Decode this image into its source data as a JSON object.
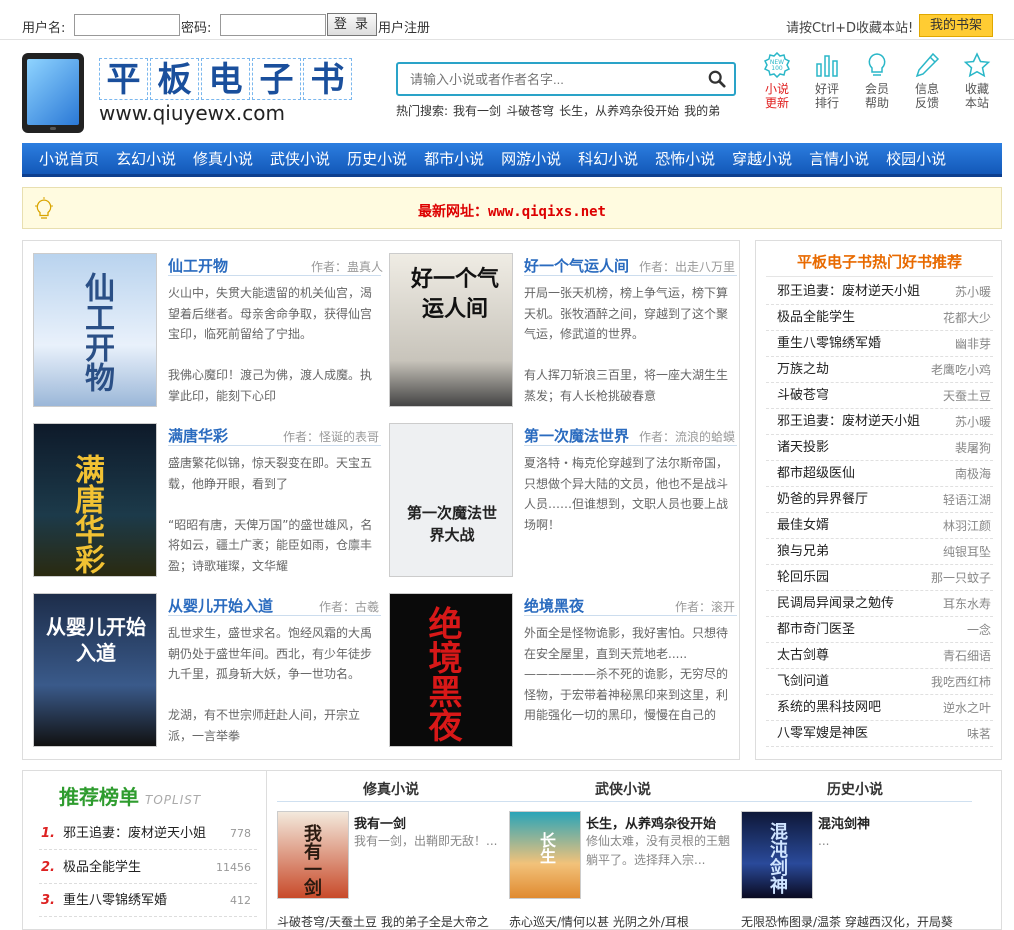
{
  "topbar": {
    "username_label": "用户名:",
    "username_value": "",
    "password_label": "密码:",
    "password_value": "",
    "login_label": "登 录",
    "register_label": "用户注册",
    "fav_tip": "请按Ctrl+D收藏本站!",
    "shelf_label": "我的书架"
  },
  "logo": {
    "chars": [
      "平",
      "板",
      "电",
      "子",
      "书"
    ],
    "url": "www.qiuyewx.com"
  },
  "search": {
    "placeholder": "请输入小说或者作者名字...",
    "hot_label": "热门搜索:",
    "hot_items": [
      "我有一剑",
      "斗破苍穹",
      "长生，从养鸡杂役开始",
      "我的弟"
    ]
  },
  "quick_icons": [
    {
      "icon": "new-icon",
      "line1": "小说",
      "line2": "更新",
      "color": "#e02020"
    },
    {
      "icon": "bar-chart-icon",
      "line1": "好评",
      "line2": "排行",
      "color": "#2ab7c8"
    },
    {
      "icon": "lightbulb-icon",
      "line1": "会员",
      "line2": "帮助",
      "color": "#2ab7c8"
    },
    {
      "icon": "pencil-icon",
      "line1": "信息",
      "line2": "反馈",
      "color": "#2ab7c8"
    },
    {
      "icon": "star-icon",
      "line1": "收藏",
      "line2": "本站",
      "color": "#2ab7c8"
    }
  ],
  "nav": [
    "小说首页",
    "玄幻小说",
    "修真小说",
    "武侠小说",
    "历史小说",
    "都市小说",
    "网游小说",
    "科幻小说",
    "恐怖小说",
    "穿越小说",
    "言情小说",
    "校园小说"
  ],
  "notice": {
    "text": "最新网址：www.qiqixs.net"
  },
  "featured": [
    {
      "title": "仙工开物",
      "author": "作者：蛊真人",
      "desc": "火山中，失贯大能遗留的机关仙宫，渴望着后继者。母亲舍命争取，获得仙宫宝印，临死前留给了宁拙。\n\n我佛心魔印！渡己为佛，渡人成魔。执掌此印，能刻下心印",
      "cover": "仙工开物"
    },
    {
      "title": "好一个气运人间",
      "author": "作者：出走八万里",
      "desc": "开局一张天机榜，榜上争气运，榜下算天机。张牧酒醉之间，穿越到了这个聚气运，修武道的世界。\n\n有人挥刀斩浪三百里，将一座大湖生生蒸发；有人长枪挑破春意",
      "cover": "好一个气运人间"
    },
    {
      "title": "满唐华彩",
      "author": "作者：怪诞的表哥",
      "desc": "盛唐繁花似锦，惊天裂变在即。天宝五载，他睁开眼，看到了\n\n“昭昭有唐，天俾万国”的盛世雄风，名将如云，疆土广袤；能臣如雨，仓廪丰盈；诗歌璀璨，文华耀",
      "cover": "满唐华彩"
    },
    {
      "title": "第一次魔法世界",
      "author": "作者：流浪的蛤蟆",
      "desc": "夏洛特・梅克伦穿越到了法尔斯帝国，只想做个异大陆的文员，他也不是战斗人员……但谁想到，文职人员也要上战场啊！",
      "cover": "第一次魔法世界大战"
    },
    {
      "title": "从婴儿开始入道",
      "author": "作者：古羲",
      "desc": "乱世求生，盛世求名。饱经风霜的大禹朝仍处于盛世年间。西北，有少年徒步九千里，孤身斩大妖，争一世功名。\n\n龙湖，有不世宗师赶赴人间，开宗立派，一言举拳",
      "cover": "从婴儿开始入道"
    },
    {
      "title": "绝境黑夜",
      "author": "作者：滚开",
      "desc": "外面全是怪物诡影，我好害怕。只想待在安全屋里，直到天荒地老.....——————杀不死的诡影，无穷尽的怪物，于宏带着神秘黑印来到这里，利用能强化一切的黑印，慢慢在自己的",
      "cover": "绝境黑夜"
    }
  ],
  "hot_recommend": {
    "title": "平板电子书热门好书推荐",
    "items": [
      {
        "name": "邪王追妻：废材逆天小姐",
        "author": "苏小暖"
      },
      {
        "name": "极品全能学生",
        "author": "花都大少"
      },
      {
        "name": "重生八零锦绣军婚",
        "author": "幽非芽"
      },
      {
        "name": "万族之劫",
        "author": "老鹰吃小鸡"
      },
      {
        "name": "斗破苍穹",
        "author": "天蚕土豆"
      },
      {
        "name": "邪王追妻：废材逆天小姐",
        "author": "苏小暖"
      },
      {
        "name": "诸天投影",
        "author": "裴屠狗"
      },
      {
        "name": "都市超级医仙",
        "author": "南极海"
      },
      {
        "name": "奶爸的异界餐厅",
        "author": "轻语江湖"
      },
      {
        "name": "最佳女婿",
        "author": "林羽江颜"
      },
      {
        "name": "狼与兄弟",
        "author": "纯银耳坠"
      },
      {
        "name": "轮回乐园",
        "author": "那一只蚊子"
      },
      {
        "name": "民调局异闻录之勉传",
        "author": "耳东水寿"
      },
      {
        "name": "都市奇门医圣",
        "author": "一念"
      },
      {
        "name": "太古剑尊",
        "author": "青石细语"
      },
      {
        "name": "飞剑问道",
        "author": "我吃西红柿"
      },
      {
        "name": "系统的黑科技网吧",
        "author": "逆水之叶"
      },
      {
        "name": "八零军嫂是神医",
        "author": "味茗"
      }
    ]
  },
  "toplist": {
    "title": "推荐榜单",
    "subtitle": "TOPLIST",
    "items": [
      {
        "rank": "1.",
        "name": "邪王追妻：废材逆天小姐",
        "count": "778"
      },
      {
        "rank": "2.",
        "name": "极品全能学生",
        "count": "11456"
      },
      {
        "rank": "3.",
        "name": "重生八零锦绣军婚",
        "count": "412"
      }
    ]
  },
  "categories": [
    {
      "tab": "修真小说",
      "book": {
        "title": "我有一剑",
        "desc": "我有一剑，出鞘即无敌！...",
        "cover": "我有一剑"
      },
      "bottom": "斗破苍穹/天蚕土豆  我的弟子全是大帝之"
    },
    {
      "tab": "武侠小说",
      "book": {
        "title": "长生，从养鸡杂役开始",
        "desc": "修仙太难，没有灵根的王魍躺平了。选择拜入宗...",
        "cover": "长生"
      },
      "bottom": "赤心巡天/情何以甚  光阴之外/耳根"
    },
    {
      "tab": "历史小说",
      "book": {
        "title": "混沌剑神",
        "desc": "...",
        "cover": "混沌剑神"
      },
      "bottom": "无限恐怖图录/温茶  穿越西汉化，开局葵"
    }
  ]
}
